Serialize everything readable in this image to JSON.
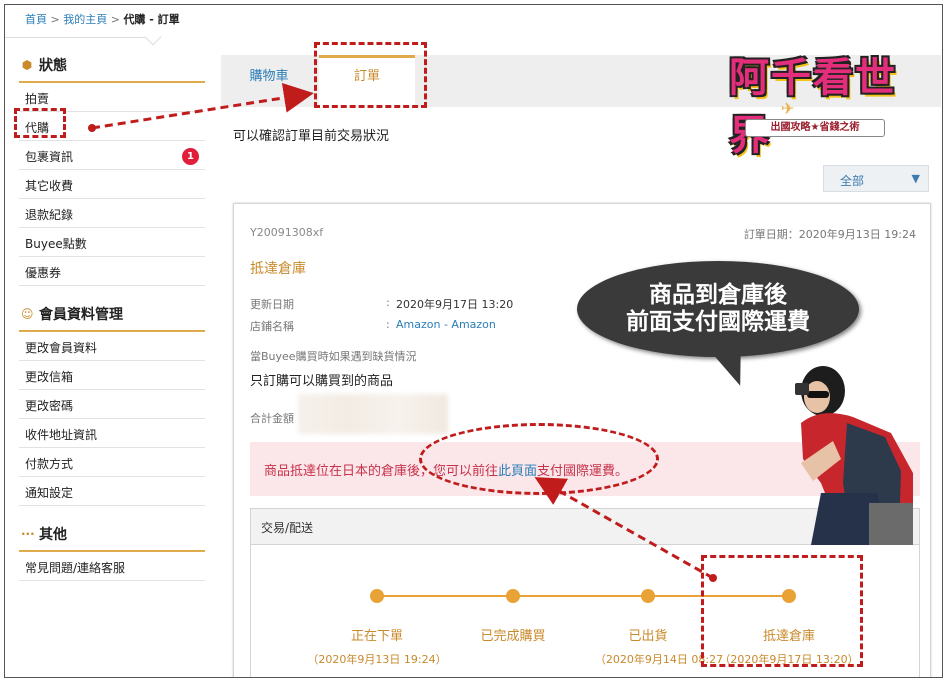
{
  "breadcrumb": {
    "home": "首頁",
    "sep1": ">",
    "mypage": "我的主頁",
    "sep2": ">",
    "current": "代購 - 訂單"
  },
  "sidebar": {
    "status_title": "狀態",
    "status_items": [
      {
        "label": "拍賣"
      },
      {
        "label": "代購"
      },
      {
        "label": "包裹資訊",
        "badge": "1"
      },
      {
        "label": "其它收費"
      },
      {
        "label": "退款紀錄"
      },
      {
        "label": "Buyee點數"
      },
      {
        "label": "優惠券"
      }
    ],
    "member_title": "會員資料管理",
    "member_items": [
      {
        "label": "更改會員資料"
      },
      {
        "label": "更改信箱"
      },
      {
        "label": "更改密碼"
      },
      {
        "label": "收件地址資訊"
      },
      {
        "label": "付款方式"
      },
      {
        "label": "通知設定"
      }
    ],
    "other_title": "其他",
    "other_items": [
      {
        "label": "常見問題/連絡客服"
      }
    ]
  },
  "tabs": [
    {
      "label": "購物車"
    },
    {
      "label": "訂單"
    }
  ],
  "intro": "可以確認訂單目前交易狀況",
  "filter": {
    "selected": "全部",
    "arrow": "▼"
  },
  "order": {
    "id": "Y20091308xf",
    "date": "訂單日期：2020年9月13日 19:24",
    "status": "抵達倉庫",
    "updated_label": "更新日期",
    "updated_value": "2020年9月17日 13:20",
    "store_label": "店鋪名稱",
    "store_value": "Amazon - Amazon",
    "colon": ":",
    "note_label": "當Buyee購買時如果遇到缺貨情況",
    "note_value": "只訂購可以購買到的商品",
    "total_label": "合計金額",
    "alert_before": "商品抵達位在日本的倉庫後，您可以前往",
    "alert_link": "此頁面",
    "alert_after": "支付國際運費。",
    "shipping_title": "交易/配送",
    "steps": [
      {
        "label": "正在下單",
        "date": "（2020年9月13日 19:24）"
      },
      {
        "label": "已完成購買",
        "date": ""
      },
      {
        "label": "已出貨",
        "date": "（2020年9月14日 08:27"
      },
      {
        "label": "抵達倉庫",
        "date": "（2020年9月17日 13:20）"
      }
    ]
  },
  "logo": {
    "title": "阿千看世界",
    "subtitle": "出國攻略★省錢之術"
  },
  "bubble": {
    "line1": "商品到倉庫後",
    "line2": "前面支付國際運費"
  },
  "colors": {
    "accent": "#e0a94a",
    "link": "#2a7db8",
    "alert_bg": "#fbe6ea",
    "alert_text": "#c8314a",
    "annotation": "#c11c1c"
  },
  "icons": {
    "status": "box-icon",
    "member": "person-icon",
    "other": "ellipsis-icon"
  }
}
